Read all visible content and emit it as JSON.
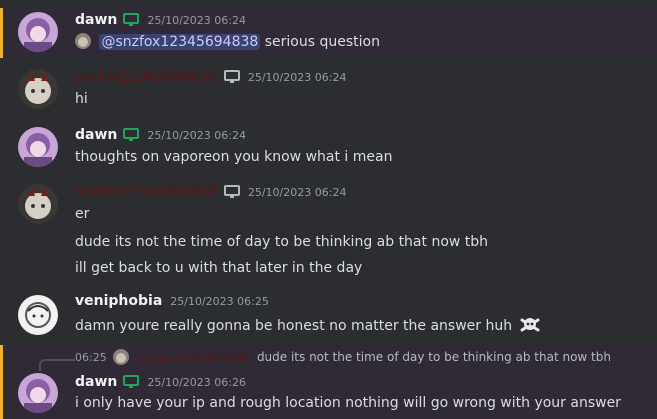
{
  "messages": [
    {
      "user": "dawn",
      "time": "25/10/2023 06:24",
      "mention": "@snzfox12345694838",
      "text": "serious question"
    },
    {
      "user": "snzfox12345694838",
      "time": "25/10/2023 06:24",
      "lines": [
        "hi"
      ]
    },
    {
      "user": "dawn",
      "time": "25/10/2023 06:24",
      "lines": [
        "thoughts on vaporeon you know what i mean"
      ]
    },
    {
      "user": "snzfox12345694838",
      "time": "25/10/2023 06:24",
      "lines": [
        "er",
        "dude its not the time of day to be thinking ab that now tbh",
        "ill get back to u with that later in the day"
      ]
    },
    {
      "user": "veniphobia",
      "time": "25/10/2023 06:25",
      "lines": [
        "damn youre really gonna be honest no matter the answer huh"
      ]
    },
    {
      "reply": {
        "time": "06:25",
        "user": "snzfox12345694838",
        "text": "dude its not the time of day to be thinking ab that now tbh"
      },
      "user": "dawn",
      "time": "25/10/2023 06:26",
      "lines": [
        "i only have your ip and rough location nothing will go wrong with your answer"
      ]
    }
  ],
  "icons": {
    "desktop_online": "monitor-icon-green",
    "desktop_idle": "monitor-icon-gray",
    "emoji": "skull-crossbones-icon"
  },
  "colors": {
    "background": "#2b2d31",
    "mention_highlight": "#2f2a35",
    "mention_border": "#f0b232",
    "status_online": "#23a55a",
    "dim_username": "#5d1515"
  }
}
